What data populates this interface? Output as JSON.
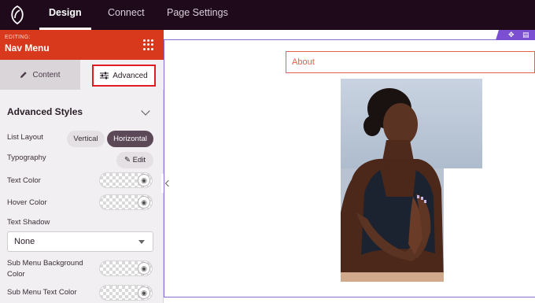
{
  "topbar": {
    "tabs": [
      {
        "label": "Design",
        "active": true
      },
      {
        "label": "Connect",
        "active": false
      },
      {
        "label": "Page Settings",
        "active": false
      }
    ]
  },
  "panel": {
    "editing_label": "EDITING:",
    "element_name": "Nav Menu",
    "tabs": {
      "content": "Content",
      "advanced": "Advanced"
    },
    "section_title": "Advanced Styles",
    "list_layout": {
      "label": "List Layout",
      "options": [
        "Vertical",
        "Horizontal"
      ],
      "selected": "Horizontal"
    },
    "typography": {
      "label": "Typography",
      "button": "Edit"
    },
    "text_color": {
      "label": "Text Color"
    },
    "hover_color": {
      "label": "Hover Color"
    },
    "text_shadow": {
      "label": "Text Shadow",
      "value": "None"
    },
    "submenu_bg_color": {
      "label": "Sub Menu Background Color"
    },
    "submenu_text_color": {
      "label": "Sub Menu Text Color"
    }
  },
  "canvas": {
    "nav_items": [
      "About"
    ]
  },
  "colors": {
    "topbar_bg": "#1f0a1c",
    "header_accent": "#d8391d",
    "highlight_border": "#e01b22",
    "selected_segment": "#5b4958",
    "canvas_outline": "#8a6bd6",
    "nav_link": "#e0614d"
  }
}
